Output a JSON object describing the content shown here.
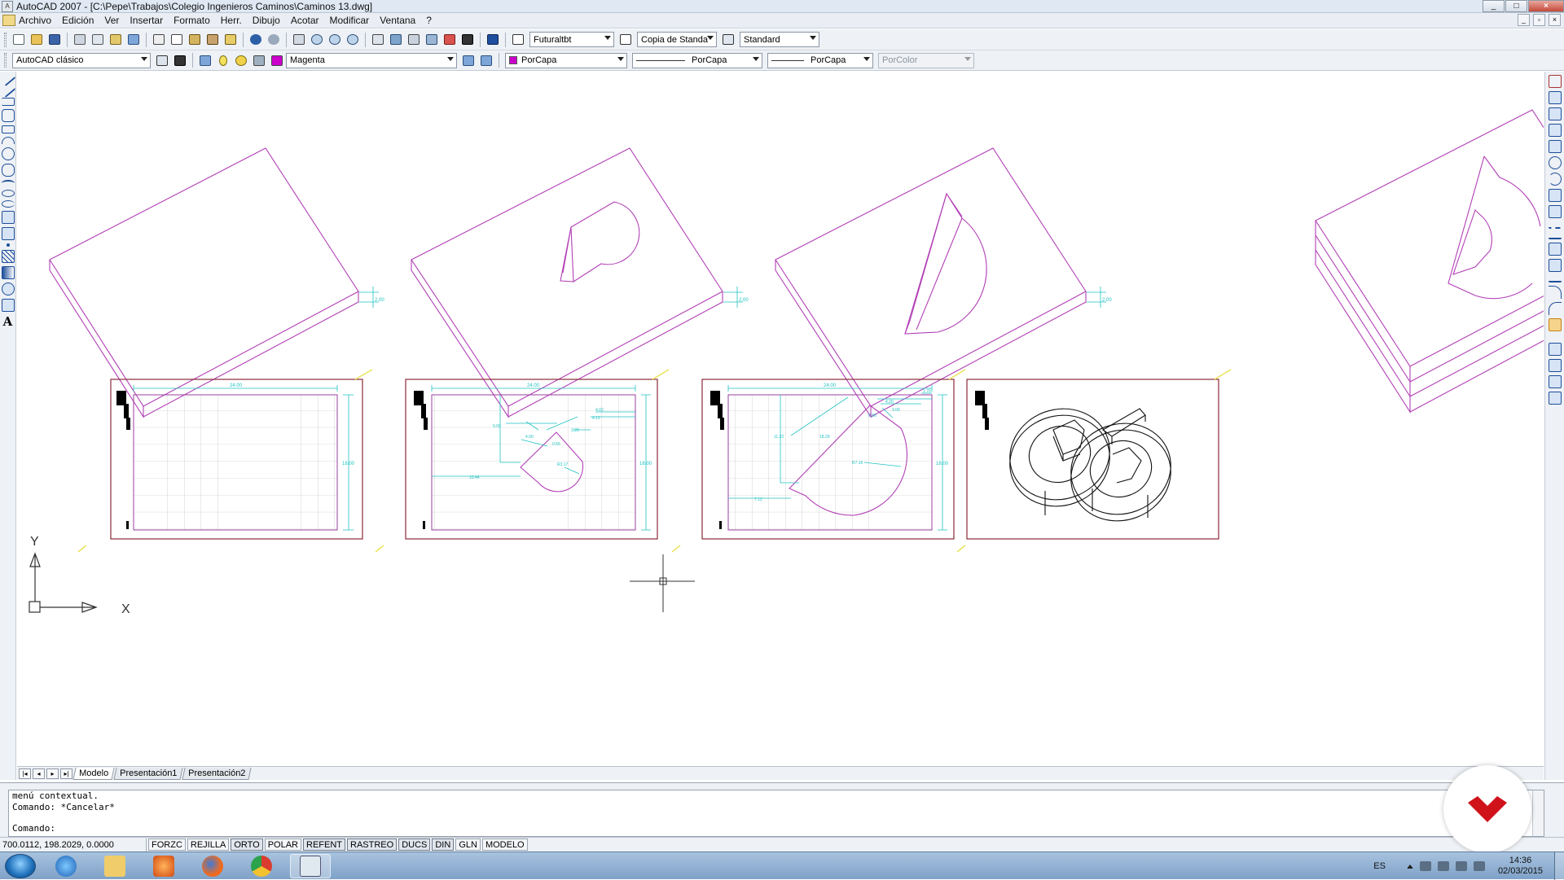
{
  "window": {
    "title": "AutoCAD 2007 - [C:\\Pepe\\Trabajos\\Colegio Ingenieros Caminos\\Caminos 13.dwg]",
    "buttons": [
      "_",
      "□",
      "×"
    ]
  },
  "menu": {
    "items": [
      "Archivo",
      "Edición",
      "Ver",
      "Insertar",
      "Formato",
      "Herr.",
      "Dibujo",
      "Acotar",
      "Modificar",
      "Ventana",
      "?"
    ]
  },
  "toolbar1": {
    "text_style": "Futuraltbt",
    "dim_style": "Copia de Standa",
    "table_style": "Standard"
  },
  "toolbar2": {
    "workspace": "AutoCAD clásico",
    "layer": "Magenta",
    "color": "PorCapa",
    "linetype": "PorCapa",
    "lineweight": "PorCapa",
    "plotstyle": "PorColor",
    "layer_color": "#cc00cc",
    "object_color": "#cc00cc"
  },
  "drawing": {
    "dims_3d": [
      "2.00",
      "2.00",
      "2.00"
    ],
    "sheet1": {
      "top": "24.00",
      "right": "18.00"
    },
    "sheet2": {
      "top": "24.00",
      "right": "18.00",
      "d1": "9.00",
      "d2": "10.44",
      "d3": "R3.17",
      "d4": "3.20",
      "d5": "4.02",
      "d6": "4.12",
      "d7": "0.55",
      "d8": "4.00"
    },
    "sheet3": {
      "top": "24.00",
      "right": "18.00",
      "d1": "11.22",
      "d2": "7.12",
      "d3": "R7.16",
      "d4": "18.29",
      "d5": "0.56",
      "d6": "4.20",
      "d7": "3.00",
      "d8": "1.76"
    },
    "axis_x": "X",
    "axis_y": "Y",
    "magenta": "#b23fb6",
    "cyan": "#21c2c2",
    "frame": "#8a2a3a"
  },
  "layout_tabs": [
    "Modelo",
    "Presentación1",
    "Presentación2"
  ],
  "command": {
    "lines": [
      "menú contextual.",
      "Comando: *Cancelar*"
    ],
    "prompt": "Comando:"
  },
  "status": {
    "coords": "700.0112, 198.2029, 0.0000",
    "buttons": [
      "FORZC",
      "REJILLA",
      "ORTO",
      "POLAR",
      "REFENT",
      "RASTREO",
      "DUCS",
      "DIN",
      "GLN",
      "MODELO"
    ]
  },
  "taskbar": {
    "apps": [
      "internet-explorer",
      "file-explorer",
      "media-player",
      "firefox",
      "chrome",
      "autocad"
    ],
    "lang": "ES",
    "time": "14:36",
    "date": "02/03/2015"
  }
}
